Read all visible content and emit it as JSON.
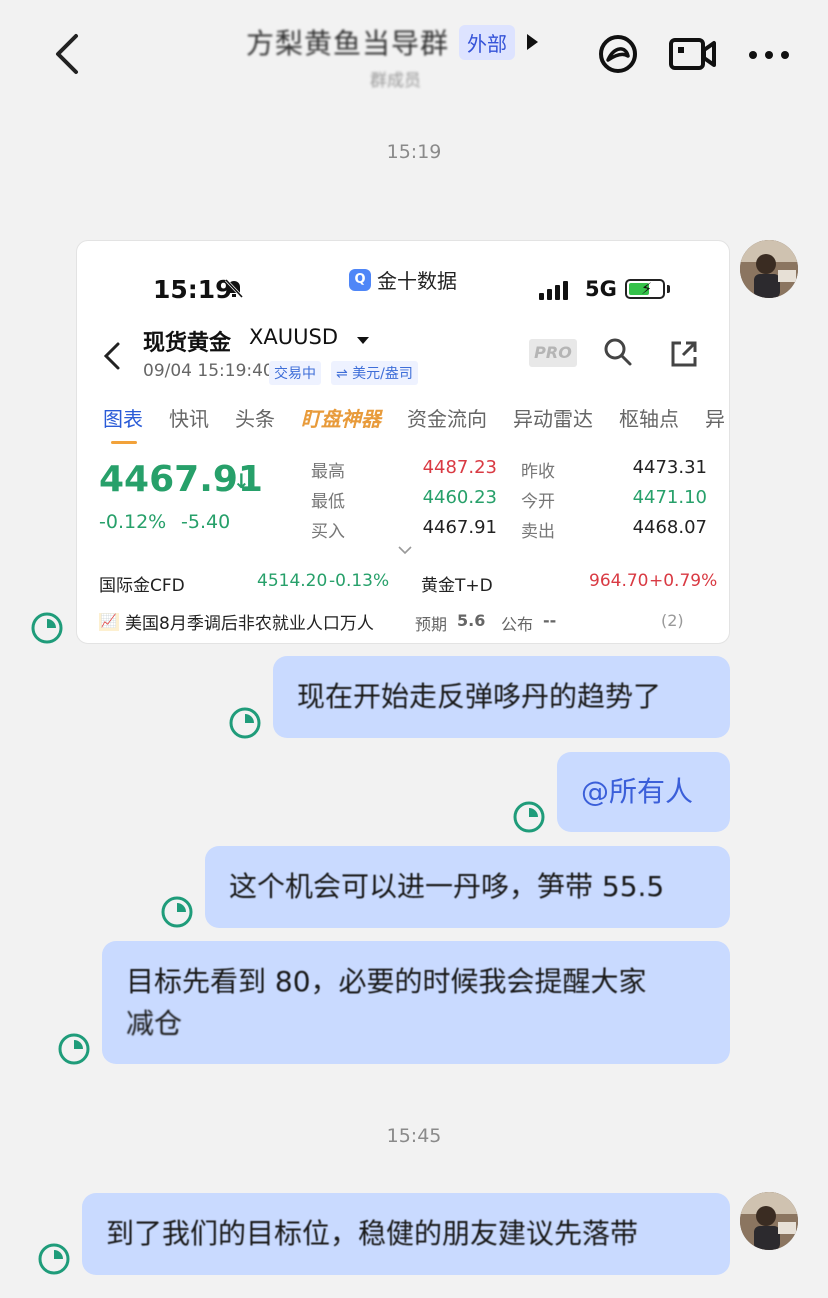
{
  "header": {
    "title": "方梨黄鱼当导群",
    "badge": "外部",
    "subtitle": "群成员"
  },
  "times": [
    "15:19",
    "15:45"
  ],
  "screenshot": {
    "status_time": "15:19",
    "app_name": "金十数据",
    "network": "5G",
    "quote_name": "现货黄金",
    "quote_code": "XAUUSD",
    "datetime": "09/04 15:19:40",
    "tags": [
      "交易中",
      "⇌ 美元/盎司"
    ],
    "pro": "PRO",
    "tabs": [
      "图表",
      "快讯",
      "头条",
      "盯盘神器",
      "资金流向",
      "异动雷达",
      "枢轴点",
      "异"
    ],
    "price": "4467.91",
    "change_pct": "-0.12%",
    "change_abs": "-5.40",
    "stats": [
      {
        "label": "最高",
        "value": "4487.23",
        "label2": "昨收",
        "value2": "4473.31"
      },
      {
        "label": "最低",
        "value": "4460.23",
        "label2": "今开",
        "value2": "4471.10"
      },
      {
        "label": "买入",
        "value": "4467.91",
        "label2": "卖出",
        "value2": "4468.07"
      }
    ],
    "cfd_label": "国际金CFD",
    "cfd_value": "4514.20",
    "cfd_chg": "-0.13%",
    "td_label": "黄金T+D",
    "td_value": "964.70",
    "td_chg": "+0.79%",
    "news_title": "美国8月季调后非农就业人口万人",
    "news_forecast_label": "预期",
    "news_forecast": "5.6",
    "news_actual_label": "公布",
    "news_actual": "--",
    "news_count": "(2)"
  },
  "messages": [
    {
      "text": "现在开始走反弹哆丹的趋势了"
    },
    {
      "text": "@所有人"
    },
    {
      "text": "这个机会可以进一丹哆，笋带 55.5"
    },
    {
      "line1": "目标先看到 80，必要的时候我会提醒大家",
      "line2": "减仓"
    },
    {
      "text": "到了我们的目标位，稳健的朋友建议先落带"
    }
  ],
  "colors": {
    "bubble": "#c9daff",
    "receipt": "#1f9c7a",
    "up": "#d93a43",
    "down": "#27a06a"
  }
}
